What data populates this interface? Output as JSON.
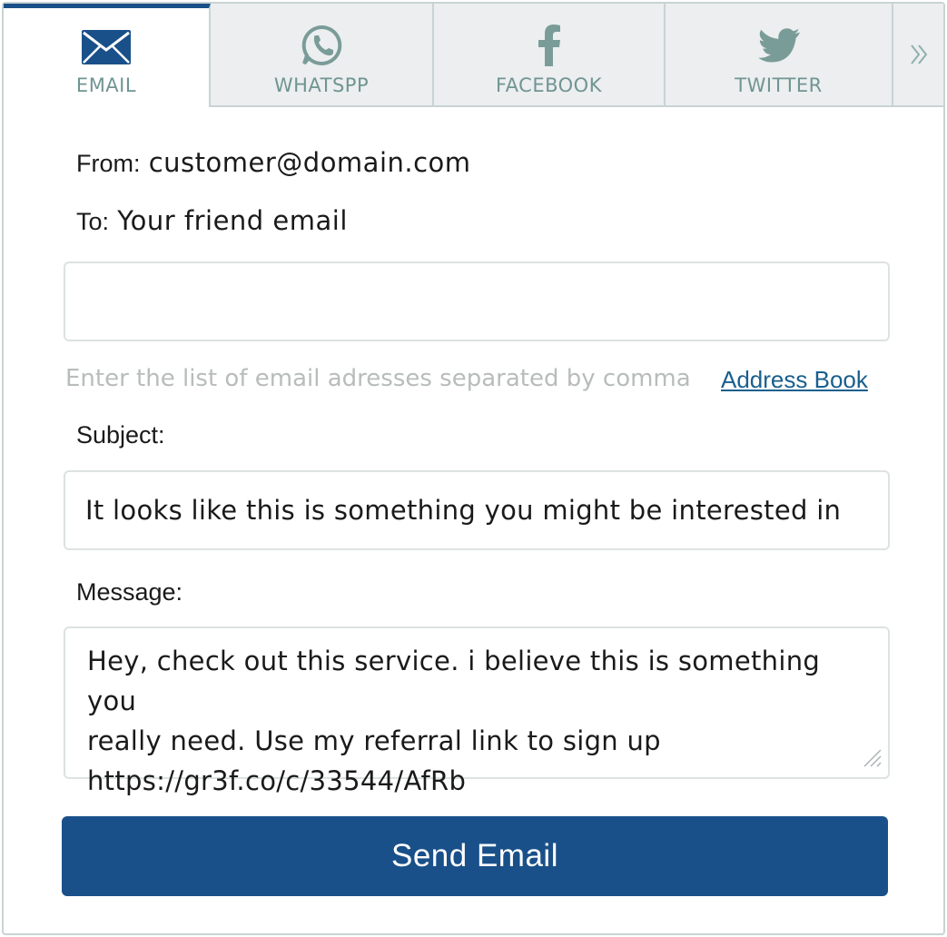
{
  "tabs": [
    {
      "label": "EMAIL",
      "icon": "envelope-icon",
      "active": true
    },
    {
      "label": "WHATSPP",
      "icon": "whatsapp-icon",
      "active": false
    },
    {
      "label": "FACEBOOK",
      "icon": "facebook-icon",
      "active": false
    },
    {
      "label": "TWITTER",
      "icon": "twitter-icon",
      "active": false
    }
  ],
  "more_icon": "double-chevron-right-icon",
  "form": {
    "from_label": "From:",
    "from_value": "customer@domain.com",
    "to_label": "To:",
    "to_value": "Your friend email",
    "to_input_value": "",
    "to_hint": "Enter the list of email adresses separated by comma",
    "address_book_link": "Address Book",
    "subject_label": "Subject:",
    "subject_value": "It looks like this is something you might be interested in",
    "message_label": "Message:",
    "message_lines": [
      "Hey, check out this service. i believe this is something you",
      "really need. Use my referral link to sign up",
      "https://gr3f.co/c/33544/AfRb"
    ],
    "send_label": "Send Email"
  },
  "colors": {
    "accent": "#1a5089",
    "tab_text": "#6f9592",
    "tab_bg": "#eceeef",
    "link": "#1a5f8e",
    "hint": "#b8bcbc"
  }
}
